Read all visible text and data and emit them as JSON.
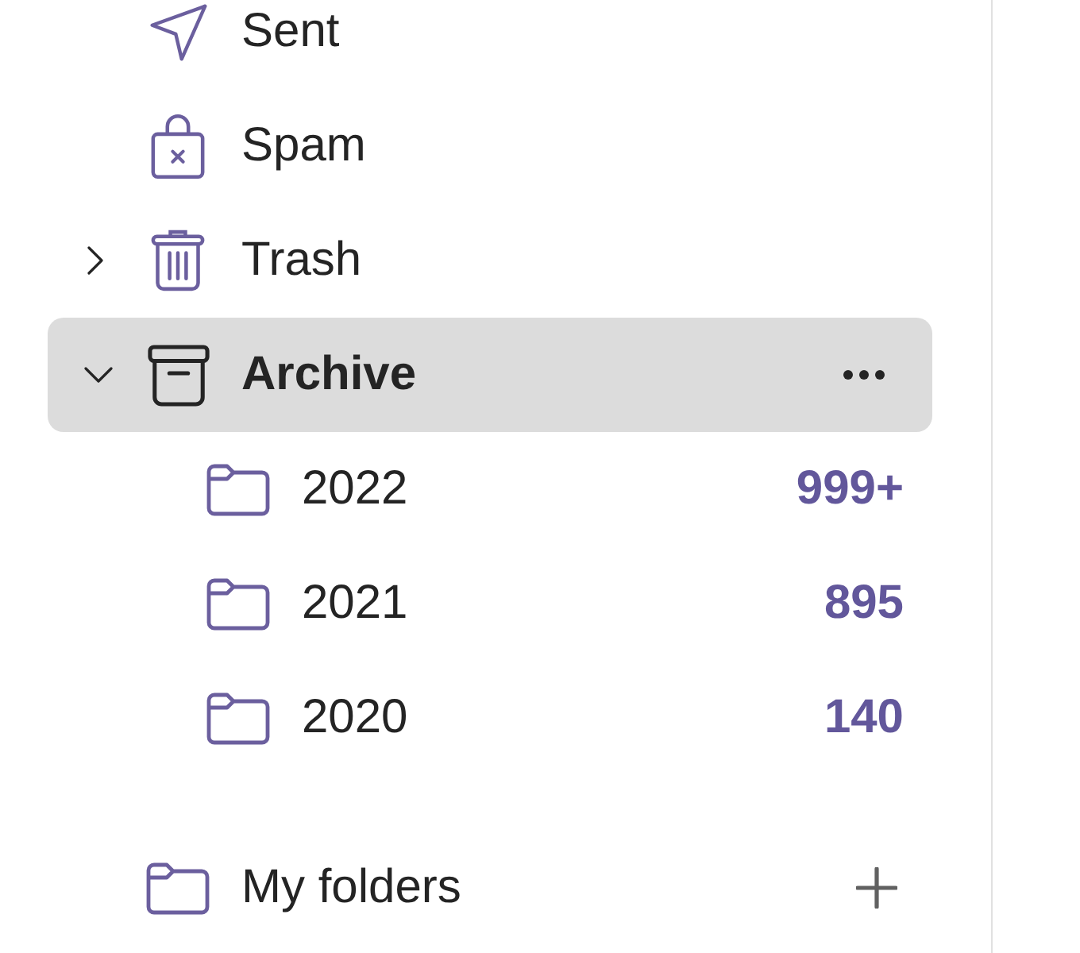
{
  "folders": [
    {
      "name": "Sent",
      "kind": "sent",
      "selected": false
    },
    {
      "name": "Spam",
      "kind": "spam",
      "selected": false
    },
    {
      "name": "Trash",
      "kind": "trash",
      "expanded": false,
      "selected": false
    },
    {
      "name": "Archive",
      "kind": "archive",
      "expanded": true,
      "selected": true,
      "children": [
        {
          "name": "2022",
          "count": "999+",
          "selected": false
        },
        {
          "name": "2021",
          "count": "895",
          "selected": false
        },
        {
          "name": "2020",
          "count": "140",
          "selected": false
        }
      ]
    }
  ],
  "my_folders": {
    "label": "My folders"
  }
}
